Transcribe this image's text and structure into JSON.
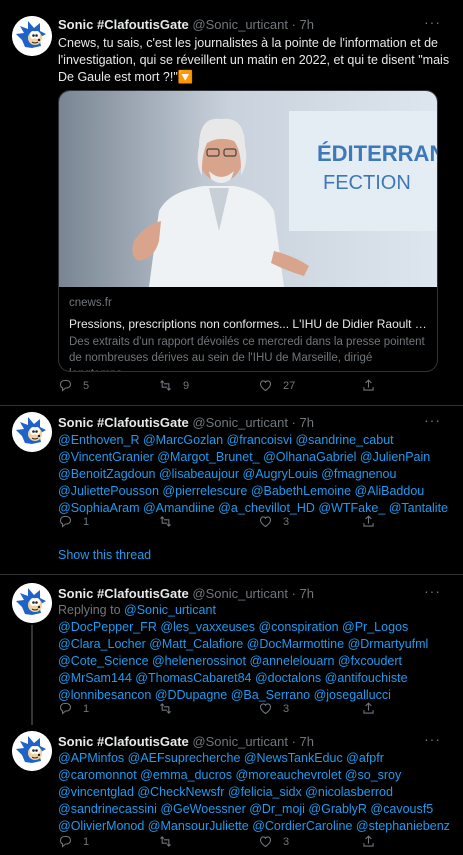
{
  "tweets": [
    {
      "name": "Sonic #ClafoutisGate",
      "handle": "@Sonic_urticant · 7h",
      "text": "Cnews, tu sais, c'est les journalistes à la pointe de l'information et de l'investigation, qui se réveillent un matin en 2022, et qui te disent \"mais De Gaule est mort ?!\"🔽",
      "card": {
        "domain": "cnews.fr",
        "title": "Pressions, prescriptions non conformes... L'IHU de Didier Raoult acca...",
        "description": "Des extraits d'un rapport dévoilés ce mercredi dans la presse pointent de nombreuses dérives au sein de l'IHU de Marseille, dirigé longtemps...",
        "image_sign": "ÉDITERRANÉE\nFECTION"
      },
      "replies": "5",
      "retweets": "9",
      "likes": "27"
    },
    {
      "name": "Sonic #ClafoutisGate",
      "handle": "@Sonic_urticant · 7h",
      "text": "@Enthoven_R @MarcGozlan @francoisvi @sandrine_cabut @VincentGranier @Margot_Brunet_ @OlhanaGabriel @JulienPain @BenoitZagdoun @lisabeaujour @AugryLouis @fmagnenou @JuliettePousson @pierrelescure @BabethLemoine @AliBaddou @SophiaAram @Amandiine @a_chevillot_HD @WTFake_ @Tantalite",
      "replies": "1",
      "retweets": "",
      "likes": "3"
    },
    {
      "name": "Sonic #ClafoutisGate",
      "handle": "@Sonic_urticant · 7h",
      "reply_to_label": "Replying to",
      "reply_to_handle": "@Sonic_urticant",
      "text": "@DocPepper_FR @les_vaxxeuses @conspiration @Pr_Logos @Clara_Locher @Matt_Calafiore @DocMarmottine @Drmartyufml @Cote_Science @helenerossinot @annelelouarn @fxcoudert @MrSam144 @ThomasCabaret84 @doctalons @antifouchiste @lonnibesancon @DDupagne @Ba_Serrano @josegallucci",
      "replies": "1",
      "retweets": "",
      "likes": "3"
    },
    {
      "name": "Sonic #ClafoutisGate",
      "handle": "@Sonic_urticant · 7h",
      "text": "@APMinfos @AEFsuprecherche @NewsTankEduc @afpfr @caromonnot @emma_ducros @moreauchevrolet @so_sroy @vincentglad @CheckNewsfr @felicia_sidx @nicolasberrod @sandrinecassini @GeWoessner @Dr_moji @GrablyR @cavousf5 @OlivierMonod @MansourJuliette @CordierCaroline @stephaniebenz",
      "replies": "1",
      "retweets": "",
      "likes": "3"
    }
  ],
  "show_thread": "Show this thread",
  "more_icon": "···",
  "icons": [
    "reply-icon",
    "retweet-icon",
    "like-icon",
    "share-icon",
    "more-icon"
  ],
  "colors": {
    "accent": "#1d9bf0",
    "muted": "#71767b",
    "background": "#000000"
  }
}
